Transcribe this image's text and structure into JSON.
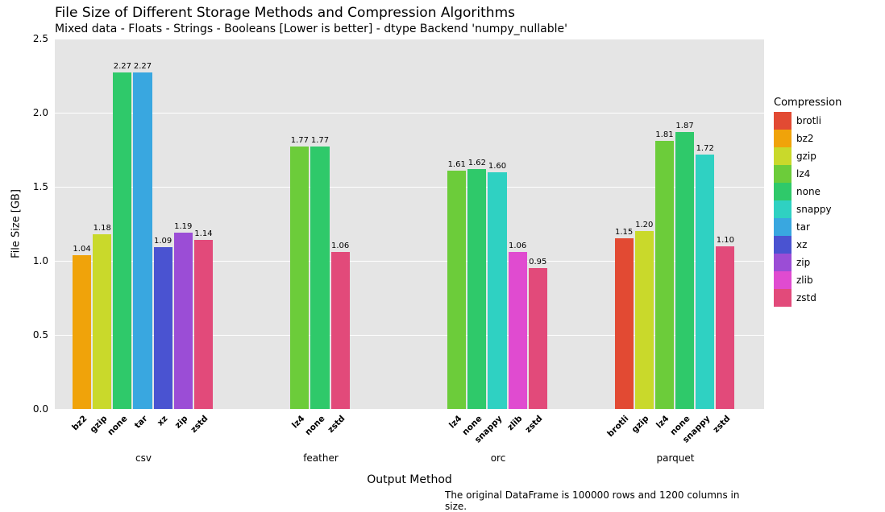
{
  "chart_data": {
    "type": "bar",
    "title": "File Size of Different Storage Methods and Compression Algorithms",
    "subtitle": "Mixed data - Floats - Strings - Booleans [Lower is better] - dtype Backend 'numpy_nullable'",
    "xlabel": "Output Method",
    "ylabel": "File Size [GB]",
    "ylim": [
      0,
      2.5
    ],
    "yticks": [
      0.0,
      0.5,
      1.0,
      1.5,
      2.0,
      2.5
    ],
    "footnote": "The original DataFrame is 100000 rows and 1200 columns in size.",
    "legend_title": "Compression",
    "compression_order": [
      "brotli",
      "bz2",
      "gzip",
      "lz4",
      "none",
      "snappy",
      "tar",
      "xz",
      "zip",
      "zlib",
      "zstd"
    ],
    "colors": {
      "brotli": "#e24a33",
      "bz2": "#f0a30a",
      "gzip": "#c9d92b",
      "lz4": "#6ccc3a",
      "none": "#2fc96a",
      "snappy": "#2fd1c2",
      "tar": "#39a7e0",
      "xz": "#4a53d1",
      "zip": "#9b4dd6",
      "zlib": "#e04bd0",
      "zstd": "#e24a7a"
    },
    "groups": [
      {
        "method": "csv",
        "bars": [
          {
            "comp": "bz2",
            "value": 1.04
          },
          {
            "comp": "gzip",
            "value": 1.18
          },
          {
            "comp": "none",
            "value": 2.27
          },
          {
            "comp": "tar",
            "value": 2.27
          },
          {
            "comp": "xz",
            "value": 1.09
          },
          {
            "comp": "zip",
            "value": 1.19
          },
          {
            "comp": "zstd",
            "value": 1.14
          }
        ]
      },
      {
        "method": "feather",
        "bars": [
          {
            "comp": "lz4",
            "value": 1.77
          },
          {
            "comp": "none",
            "value": 1.77
          },
          {
            "comp": "zstd",
            "value": 1.06
          }
        ]
      },
      {
        "method": "orc",
        "bars": [
          {
            "comp": "lz4",
            "value": 1.61
          },
          {
            "comp": "none",
            "value": 1.62
          },
          {
            "comp": "snappy",
            "value": 1.6
          },
          {
            "comp": "zlib",
            "value": 1.06
          },
          {
            "comp": "zstd",
            "value": 0.95
          }
        ]
      },
      {
        "method": "parquet",
        "bars": [
          {
            "comp": "brotli",
            "value": 1.15
          },
          {
            "comp": "gzip",
            "value": 1.2
          },
          {
            "comp": "lz4",
            "value": 1.81
          },
          {
            "comp": "none",
            "value": 1.87
          },
          {
            "comp": "snappy",
            "value": 1.72
          },
          {
            "comp": "zstd",
            "value": 1.1
          }
        ]
      }
    ]
  }
}
